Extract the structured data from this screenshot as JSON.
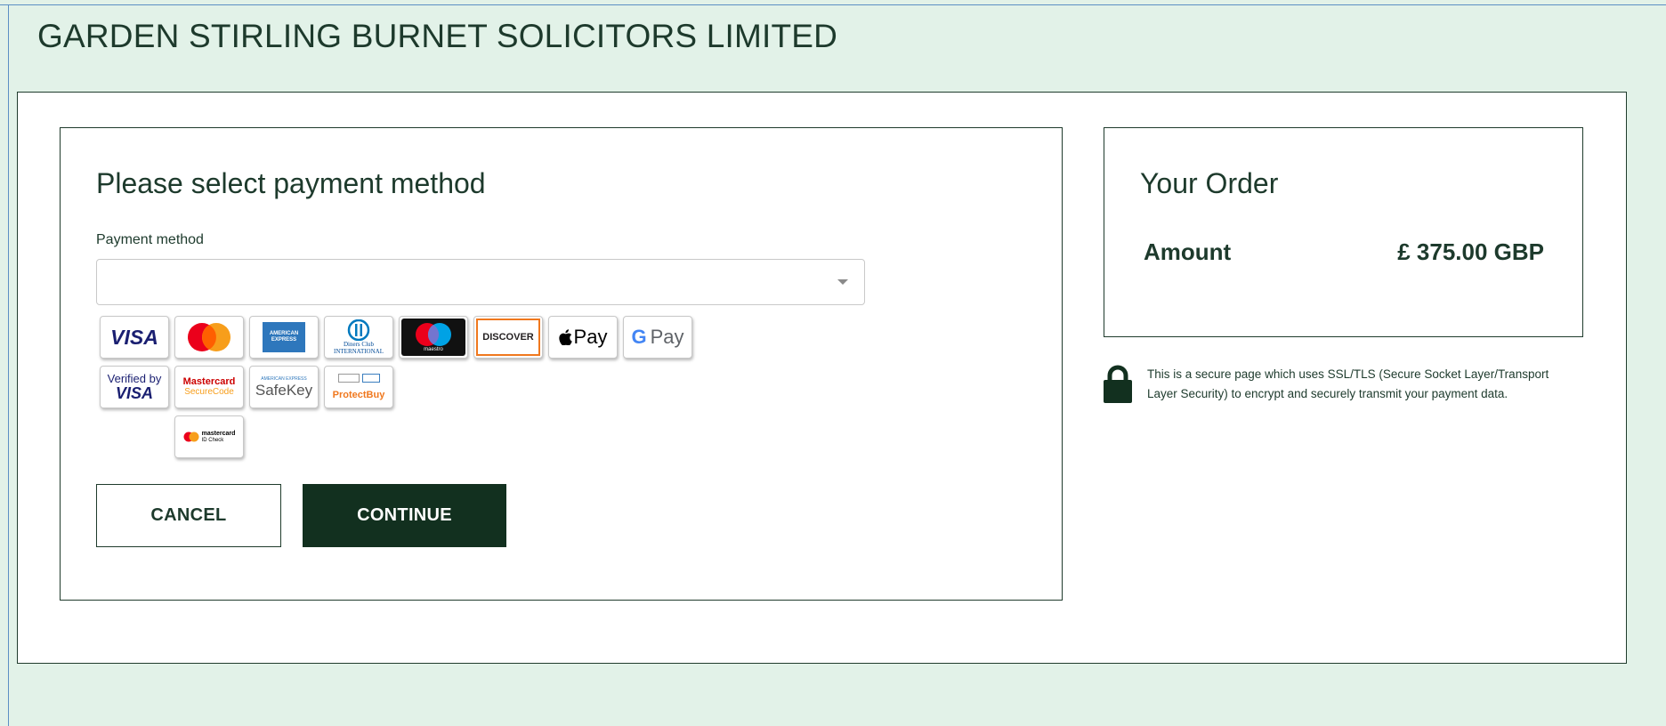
{
  "header": {
    "company_name": "GARDEN STIRLING BURNET SOLICITORS LIMITED"
  },
  "payment": {
    "heading": "Please select payment method",
    "field_label": "Payment method",
    "selected_value": "",
    "logos": [
      {
        "name": "visa",
        "text": "VISA"
      },
      {
        "name": "mastercard",
        "text": ""
      },
      {
        "name": "american-express",
        "text": "AMERICAN EXPRESS"
      },
      {
        "name": "diners-club",
        "text": "Diners Club INTERNATIONAL"
      },
      {
        "name": "maestro",
        "text": "maestro"
      },
      {
        "name": "discover",
        "text": "DISCOVER"
      },
      {
        "name": "apple-pay",
        "text": "Pay"
      },
      {
        "name": "google-pay",
        "text": "Pay"
      },
      {
        "name": "verified-by-visa",
        "text_top": "Verified by",
        "text_bottom": "VISA"
      },
      {
        "name": "mastercard-securecode",
        "text_top": "Mastercard",
        "text_bottom": "SecureCode"
      },
      {
        "name": "amex-safekey",
        "text_top": "AMERICAN EXPRESS",
        "text_bottom": "SafeKey"
      },
      {
        "name": "discover-protectbuy",
        "text": "ProtectBuy"
      },
      {
        "name": "mastercard-id-check",
        "text_top": "mastercard",
        "text_bottom": "ID Check"
      }
    ],
    "cancel_label": "CANCEL",
    "continue_label": "CONTINUE"
  },
  "order": {
    "heading": "Your Order",
    "amount_label": "Amount",
    "amount_value": "£ 375.00 GBP"
  },
  "security": {
    "notice": "This is a secure page which uses SSL/TLS (Secure Socket Layer/Transport Layer Security) to encrypt and securely transmit your payment data."
  },
  "colors": {
    "background": "#e2f2e8",
    "brand_dark": "#12301f",
    "text": "#1d3a2c"
  }
}
